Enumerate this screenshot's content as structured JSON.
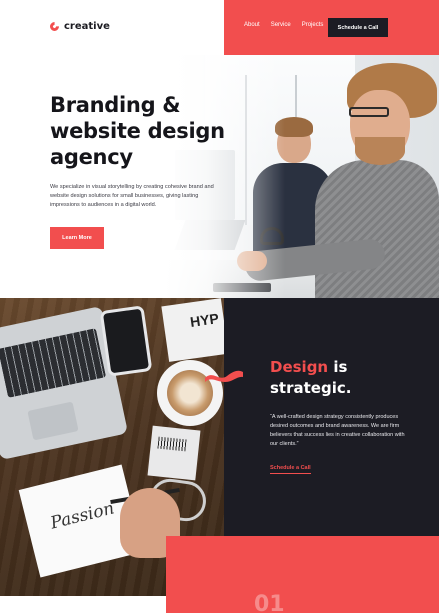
{
  "brand": {
    "name": "creative",
    "accent_color": "#f24e4e",
    "dark_color": "#1c1c24"
  },
  "nav": {
    "links": [
      "About",
      "Service",
      "Projects"
    ],
    "cta_label": "Schedule a Call"
  },
  "hero": {
    "title": "Branding & website design agency",
    "description": "We specialize in visual storytelling by creating cohesive brand and website design solutions for small businesses, giving lasting impressions to audiences in a digital world.",
    "button_label": "Learn More"
  },
  "feature": {
    "title_accent": "Design",
    "title_rest_1": " is",
    "title_rest_2": "strategic.",
    "quote": "“A well-crafted design strategy consistently produces desired outcomes and brand awareness. We are firm believers that success lies in creative collaboration with our clients.”",
    "link_label": "Schedule a Call"
  },
  "photo_text": {
    "book": "HYP",
    "sketch": "Passion"
  },
  "section_number": "01"
}
